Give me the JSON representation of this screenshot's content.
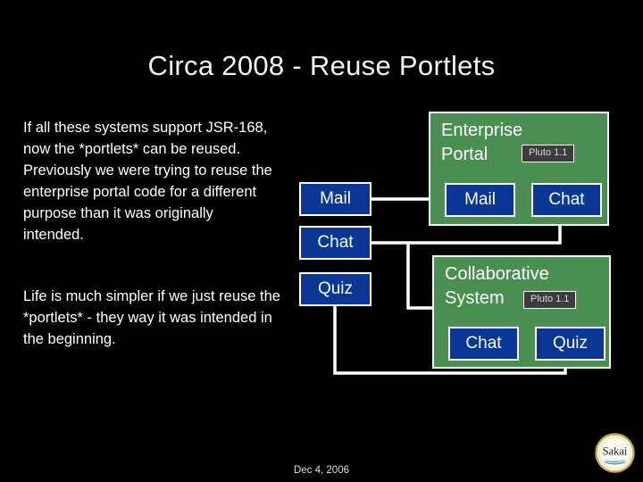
{
  "slide": {
    "title": "Circa 2008 - Reuse Portlets",
    "date": "Dec 4, 2006",
    "background_color": "#000000",
    "title_color": "#f2f2f2"
  },
  "body": {
    "paragraph_one": "If all these systems support JSR-168, now the *portlets* can be reused.   Previously we were trying to reuse the enterprise portal code for a different purpose than it was originally intended.",
    "paragraph_two": "Life is much simpler if we just reuse the *portlets* - they way it was intended in the beginning."
  },
  "diagram": {
    "colors": {
      "portlet_blue": "#0a3795",
      "system_green": "#4a8f52",
      "badge_gray": "#3c3c3c",
      "connector_white": "#ffffff"
    },
    "standalone_portlets": [
      {
        "label": "Mail"
      },
      {
        "label": "Chat"
      },
      {
        "label": "Quiz"
      }
    ],
    "systems": [
      {
        "title": "Enterprise\nPortal",
        "version_badge": "Pluto 1.1",
        "portlets": [
          {
            "label": "Mail"
          },
          {
            "label": "Chat"
          }
        ]
      },
      {
        "title": "Collaborative\nSystem",
        "version_badge": "Pluto 1.1",
        "portlets": [
          {
            "label": "Chat"
          },
          {
            "label": "Quiz"
          }
        ]
      }
    ]
  },
  "logo": {
    "wordmark": "Sakai",
    "ring_color": "#c9a94e",
    "disc_color": "#fdfbf0",
    "text_color": "#1a1a2e",
    "swoosh_color": "#2f9fc4"
  }
}
